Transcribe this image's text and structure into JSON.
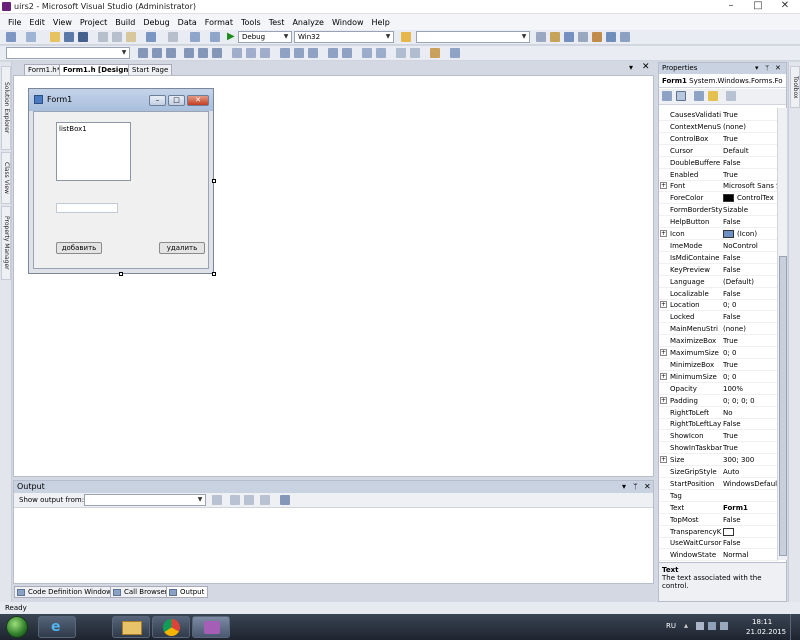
{
  "window": {
    "title": "uirs2 - Microsoft Visual Studio (Administrator)"
  },
  "menu": [
    "File",
    "Edit",
    "View",
    "Project",
    "Build",
    "Debug",
    "Data",
    "Format",
    "Tools",
    "Test",
    "Analyze",
    "Window",
    "Help"
  ],
  "toolbar": {
    "config": "Debug",
    "platform": "Win32"
  },
  "sidebar_left": {
    "solution_explorer": "Solution Explorer",
    "class_view": "Class View",
    "property_manager": "Property Manager"
  },
  "doc_tabs": [
    "Form1.h*",
    "Form1.h [Design]*",
    "Start Page"
  ],
  "form": {
    "title": "Form1",
    "listbox_label": "listBox1",
    "add_button": "добавить",
    "delete_button": "удалить"
  },
  "output": {
    "title": "Output",
    "show_from": "Show output from:"
  },
  "bottom_tabs": [
    "Code Definition Window",
    "Call Browser",
    "Output"
  ],
  "properties": {
    "title": "Properties",
    "object_name": "Form1",
    "object_type": "System.Windows.Forms.Fo",
    "rows": [
      {
        "name": "CausesValidati",
        "value": "True"
      },
      {
        "name": "ContextMenuS",
        "value": "(none)"
      },
      {
        "name": "ControlBox",
        "value": "True"
      },
      {
        "name": "Cursor",
        "value": "Default"
      },
      {
        "name": "DoubleBuffere",
        "value": "False"
      },
      {
        "name": "Enabled",
        "value": "True"
      },
      {
        "name": "Font",
        "value": "Microsoft Sans S",
        "expand": true
      },
      {
        "name": "ForeColor",
        "value": "ControlTex",
        "swatch": "#000000"
      },
      {
        "name": "FormBorderSty",
        "value": "Sizable"
      },
      {
        "name": "HelpButton",
        "value": "False"
      },
      {
        "name": "Icon",
        "value": "(Icon)",
        "expand": true,
        "icon": true
      },
      {
        "name": "ImeMode",
        "value": "NoControl"
      },
      {
        "name": "IsMdiContaine",
        "value": "False"
      },
      {
        "name": "KeyPreview",
        "value": "False"
      },
      {
        "name": "Language",
        "value": "(Default)"
      },
      {
        "name": "Localizable",
        "value": "False"
      },
      {
        "name": "Location",
        "value": "0; 0",
        "expand": true
      },
      {
        "name": "Locked",
        "value": "False"
      },
      {
        "name": "MainMenuStri",
        "value": "(none)"
      },
      {
        "name": "MaximizeBox",
        "value": "True"
      },
      {
        "name": "MaximumSize",
        "value": "0; 0",
        "expand": true
      },
      {
        "name": "MinimizeBox",
        "value": "True"
      },
      {
        "name": "MinimumSize",
        "value": "0; 0",
        "expand": true
      },
      {
        "name": "Opacity",
        "value": "100%"
      },
      {
        "name": "Padding",
        "value": "0; 0; 0; 0",
        "expand": true
      },
      {
        "name": "RightToLeft",
        "value": "No"
      },
      {
        "name": "RightToLeftLay",
        "value": "False"
      },
      {
        "name": "ShowIcon",
        "value": "True"
      },
      {
        "name": "ShowInTaskbar",
        "value": "True"
      },
      {
        "name": "Size",
        "value": "300; 300",
        "expand": true
      },
      {
        "name": "SizeGripStyle",
        "value": "Auto"
      },
      {
        "name": "StartPosition",
        "value": "WindowsDefaul"
      },
      {
        "name": "Tag",
        "value": ""
      },
      {
        "name": "Text",
        "value": "Form1",
        "bold": true
      },
      {
        "name": "TopMost",
        "value": "False"
      },
      {
        "name": "TransparencyK",
        "value": "",
        "swatch": "#ffffff"
      },
      {
        "name": "UseWaitCursor",
        "value": "False"
      },
      {
        "name": "WindowState",
        "value": "Normal"
      }
    ],
    "desc_title": "Text",
    "desc_text": "The text associated with the control."
  },
  "toolbox_label": "Toolbox",
  "status": "Ready",
  "taskbar": {
    "lang": "RU",
    "time": "18:11",
    "date": "21.02.2015"
  },
  "colors": {
    "accent": "#68217a",
    "selection_bg": "#c9d2e1"
  }
}
